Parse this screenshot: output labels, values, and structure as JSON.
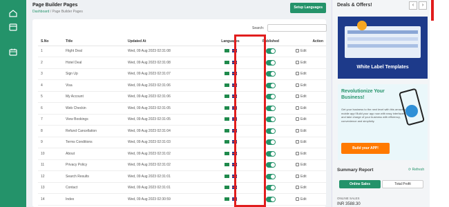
{
  "header": {
    "title": "Page Builder Pages",
    "breadcrumb": [
      "Dashboard",
      "Page Builder Pages"
    ],
    "setup_button": "Setup Languages"
  },
  "search": {
    "label": "Search:",
    "value": ""
  },
  "table": {
    "columns": [
      "S.No",
      "Title",
      "Updated At",
      "Languages",
      "Published",
      "Action"
    ],
    "rows": [
      {
        "sno": "1",
        "title": "Flight Deal",
        "updated": "Wed, 09 Aug 2023 02:31:08",
        "edit": "Edit"
      },
      {
        "sno": "2",
        "title": "Hotel Deal",
        "updated": "Wed, 09 Aug 2023 02:31:08",
        "edit": "Edit"
      },
      {
        "sno": "3",
        "title": "Sign Up",
        "updated": "Wed, 09 Aug 2023 02:31:07",
        "edit": "Edit"
      },
      {
        "sno": "4",
        "title": "Visa",
        "updated": "Wed, 09 Aug 2023 02:31:06",
        "edit": "Edit"
      },
      {
        "sno": "5",
        "title": "My Account",
        "updated": "Wed, 09 Aug 2023 02:31:06",
        "edit": "Edit"
      },
      {
        "sno": "6",
        "title": "Web Checkin",
        "updated": "Wed, 09 Aug 2023 02:31:05",
        "edit": "Edit"
      },
      {
        "sno": "7",
        "title": "View Bookings",
        "updated": "Wed, 09 Aug 2023 02:31:05",
        "edit": "Edit"
      },
      {
        "sno": "8",
        "title": "Refund Cancellation",
        "updated": "Wed, 09 Aug 2023 02:31:04",
        "edit": "Edit"
      },
      {
        "sno": "9",
        "title": "Terms Conditions",
        "updated": "Wed, 09 Aug 2023 02:31:03",
        "edit": "Edit"
      },
      {
        "sno": "10",
        "title": "About",
        "updated": "Wed, 09 Aug 2023 02:31:02",
        "edit": "Edit"
      },
      {
        "sno": "11",
        "title": "Privacy Policy",
        "updated": "Wed, 09 Aug 2023 02:31:02",
        "edit": "Edit"
      },
      {
        "sno": "12",
        "title": "Search Results",
        "updated": "Wed, 09 Aug 2023 02:31:01",
        "edit": "Edit"
      },
      {
        "sno": "13",
        "title": "Contact",
        "updated": "Wed, 09 Aug 2023 02:31:01",
        "edit": "Edit"
      },
      {
        "sno": "14",
        "title": "Index",
        "updated": "Wed, 09 Aug 2023 02:30:59",
        "edit": "Edit"
      }
    ]
  },
  "right_panel": {
    "deals_title": "Deals & Offers!",
    "prev_icon": "chevron-left-icon",
    "next_icon": "chevron-right-icon",
    "banner1_caption": "White Label Templates",
    "banner2": {
      "title": "Revolutionize Your Business!",
      "text": "Get your business to the next level with this amazing mobile app! Build your app now with easy interfaces and take charge of your business with efficiency, convenience and simplicity.",
      "button": "Build your APP!"
    },
    "summary": {
      "title": "Summary Report",
      "refresh": "Refresh",
      "tabs": [
        "Online Sales",
        "Total Profit"
      ],
      "online_label": "ONLINE SALES",
      "online_amount": "INR 3588.30"
    }
  },
  "colors": {
    "brand": "#24936a",
    "highlight": "#e11d1d",
    "accent": "#ff7a00"
  }
}
